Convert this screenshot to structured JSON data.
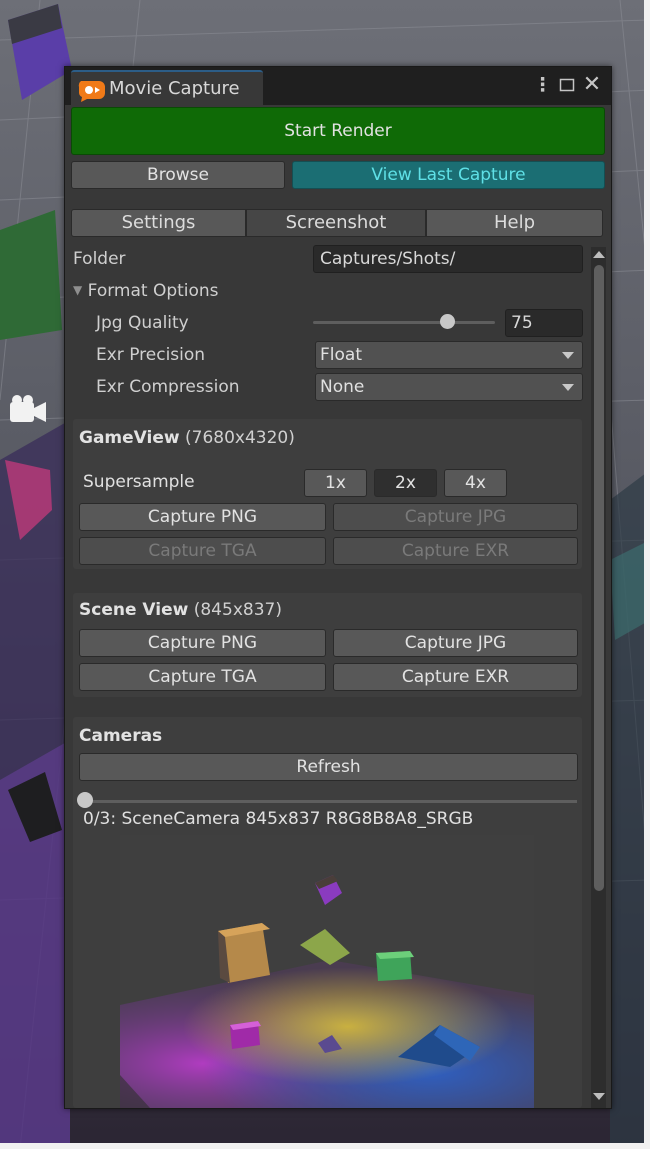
{
  "window": {
    "title": "Movie Capture",
    "menu_icon": "kebab-menu-icon",
    "maximize_icon": "maximize-icon",
    "close_icon": "close-icon",
    "colors": {
      "start_render": "#0f6a06",
      "view_last": "#1b6e73",
      "view_last_text": "#5fe0e6"
    }
  },
  "toolbar": {
    "start_render": "Start Render",
    "browse": "Browse",
    "view_last_capture": "View Last Capture"
  },
  "tabs": [
    {
      "label": "Settings",
      "selected": false
    },
    {
      "label": "Screenshot",
      "selected": true
    },
    {
      "label": "Help",
      "selected": false
    }
  ],
  "settings": {
    "folder_label": "Folder",
    "folder_value": "Captures/Shots/",
    "format_options_label": "Format Options",
    "jpg_quality_label": "Jpg Quality",
    "jpg_quality_value": "75",
    "exr_precision_label": "Exr Precision",
    "exr_precision_value": "Float",
    "exr_compression_label": "Exr Compression",
    "exr_compression_value": "None"
  },
  "gameview": {
    "title": "GameView",
    "resolution": "(7680x4320)",
    "supersample_label": "Supersample",
    "supersample_options": [
      "1x",
      "2x",
      "4x"
    ],
    "supersample_selected": "2x",
    "capture_png": "Capture PNG",
    "capture_jpg": "Capture JPG",
    "capture_tga": "Capture TGA",
    "capture_exr": "Capture EXR"
  },
  "sceneview": {
    "title": "Scene View",
    "resolution": "(845x837)",
    "capture_png": "Capture PNG",
    "capture_jpg": "Capture JPG",
    "capture_tga": "Capture TGA",
    "capture_exr": "Capture EXR"
  },
  "cameras": {
    "title": "Cameras",
    "refresh": "Refresh",
    "camera_info": "0/3: SceneCamera 845x837 R8G8B8A8_SRGB",
    "camera_index": 0,
    "camera_count": 3
  }
}
